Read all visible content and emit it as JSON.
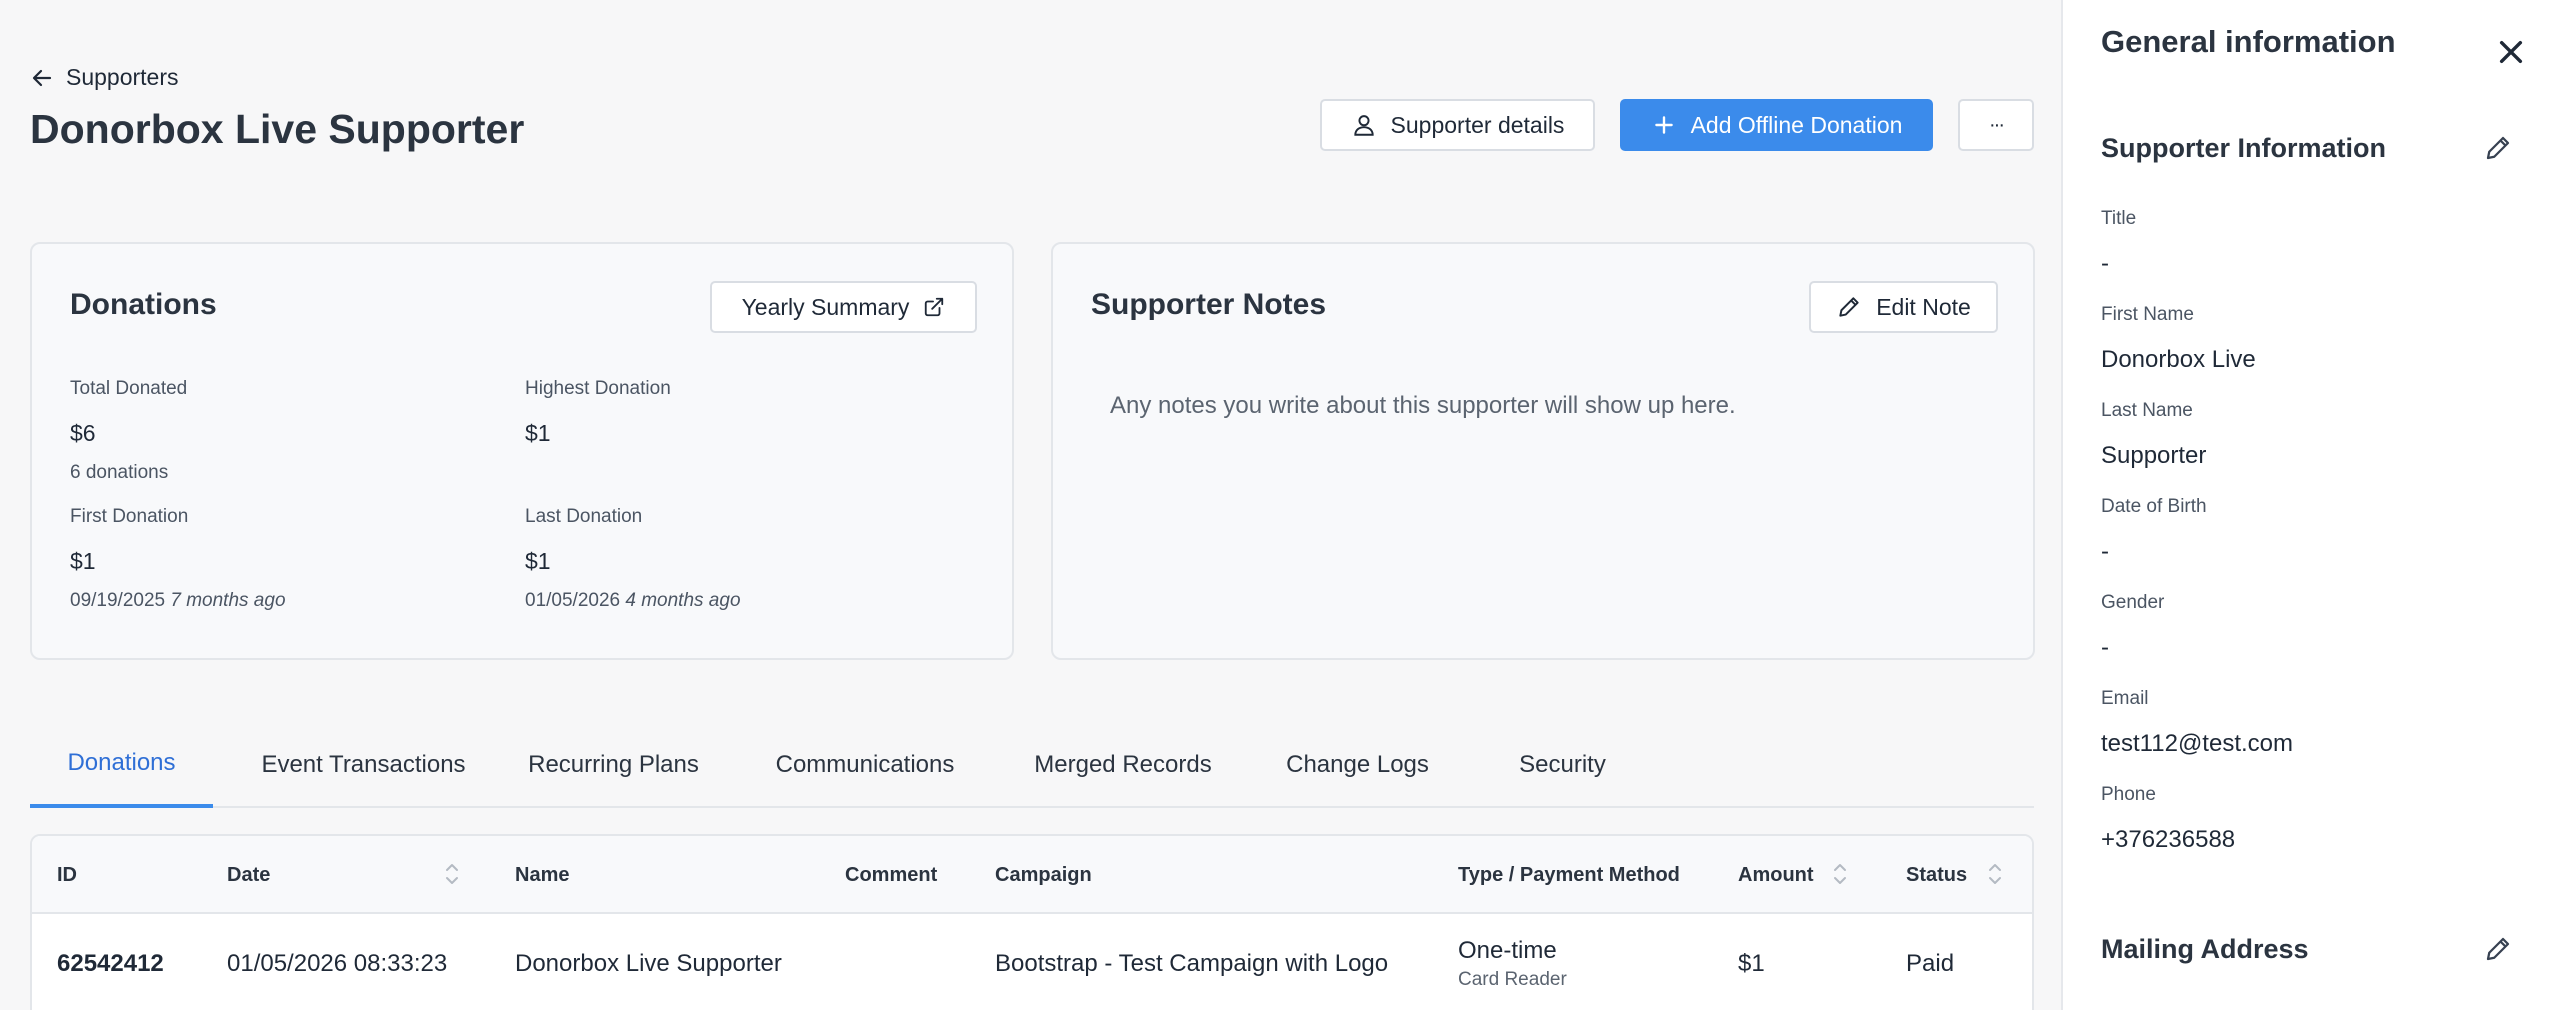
{
  "header": {
    "back_label": "Supporters",
    "title": "Donorbox Live Supporter",
    "supporter_details_label": "Supporter details",
    "add_offline_donation_label": "Add Offline Donation",
    "more_label": "···"
  },
  "donations_card": {
    "title": "Donations",
    "yearly_summary_label": "Yearly Summary",
    "total_donated": {
      "label": "Total Donated",
      "value": "$6",
      "sub": "6 donations"
    },
    "highest_donation": {
      "label": "Highest Donation",
      "value": "$1"
    },
    "first_donation": {
      "label": "First Donation",
      "value": "$1",
      "date": "09/19/2025",
      "relative": "7 months ago"
    },
    "last_donation": {
      "label": "Last Donation",
      "value": "$1",
      "date": "01/05/2026",
      "relative": "4 months ago"
    }
  },
  "notes_card": {
    "title": "Supporter Notes",
    "edit_label": "Edit Note",
    "placeholder": "Any notes you write about this supporter will show up here."
  },
  "tabs": [
    {
      "label": "Donations",
      "active": true
    },
    {
      "label": "Event Transactions"
    },
    {
      "label": "Recurring Plans"
    },
    {
      "label": "Communications"
    },
    {
      "label": "Merged Records"
    },
    {
      "label": "Change Logs"
    },
    {
      "label": "Security"
    }
  ],
  "table": {
    "columns": [
      "ID",
      "Date",
      "Name",
      "Comment",
      "Campaign",
      "Type / Payment Method",
      "Amount",
      "Status"
    ],
    "rows": [
      {
        "id": "62542412",
        "date": "01/05/2026 08:33:23",
        "name": "Donorbox Live Supporter",
        "comment": "",
        "campaign": "Bootstrap - Test Campaign with Logo",
        "type": "One-time",
        "payment_method": "Card Reader",
        "amount": "$1",
        "status": "Paid"
      }
    ]
  },
  "panel": {
    "title": "General information",
    "supporter_info_title": "Supporter Information",
    "fields": [
      {
        "label": "Title",
        "value": "-"
      },
      {
        "label": "First Name",
        "value": "Donorbox Live"
      },
      {
        "label": "Last Name",
        "value": "Supporter"
      },
      {
        "label": "Date of Birth",
        "value": "-"
      },
      {
        "label": "Gender",
        "value": "-"
      },
      {
        "label": "Email",
        "value": "test112@test.com"
      },
      {
        "label": "Phone",
        "value": "+376236588"
      }
    ],
    "mailing_address_title": "Mailing Address"
  },
  "colors": {
    "accent": "#3b8beb",
    "active_tab": "#2f6fd6",
    "background": "#f7f7f8"
  }
}
